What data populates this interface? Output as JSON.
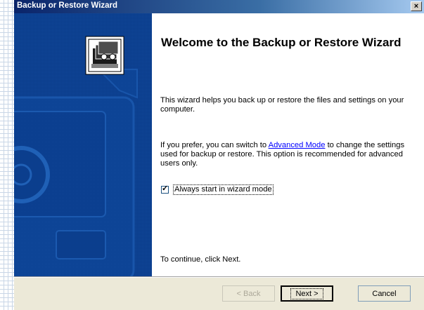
{
  "window": {
    "title": "Backup or Restore Wizard",
    "close_label": "×"
  },
  "main": {
    "heading": "Welcome to the Backup or Restore Wizard",
    "intro": "This wizard helps you back up or restore the files and settings on your computer.",
    "mode_text_before": "If you prefer, you can switch to ",
    "advanced_mode_link": "Advanced Mode",
    "mode_text_after": " to change the settings used for backup or restore. This option is recommended for advanced users only.",
    "checkbox_label": "Always start in wizard mode",
    "checkbox_checked": true,
    "continue_text": "To continue, click Next."
  },
  "footer": {
    "back_label": "< Back",
    "next_label": "Next >",
    "cancel_label": "Cancel"
  },
  "colors": {
    "sidebar_blue": "#0b3e8d",
    "title_gradient_start": "#0a246a",
    "link": "#0000ff"
  },
  "icons": {
    "wizard_icon": "backup-media-icon",
    "close": "close-icon",
    "checkmark": "checkmark-icon"
  }
}
